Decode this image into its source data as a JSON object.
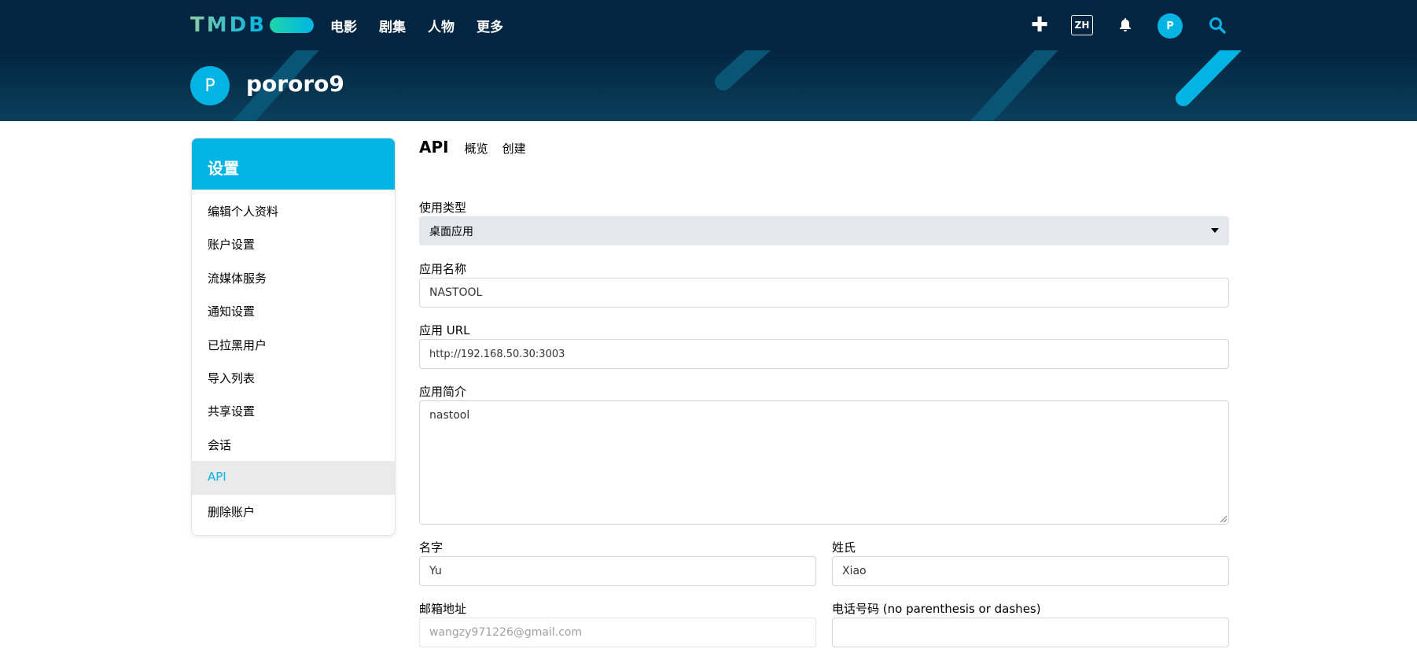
{
  "nav": {
    "logo": "TMDB",
    "links": [
      "电影",
      "剧集",
      "人物",
      "更多"
    ],
    "lang": "ZH",
    "avatar_letter": "P",
    "plus_glyph": "✚"
  },
  "profile": {
    "avatar_letter": "P",
    "username": "pororo9"
  },
  "sidebar": {
    "title": "设置",
    "items": [
      {
        "label": "编辑个人资料"
      },
      {
        "label": "账户设置"
      },
      {
        "label": "流媒体服务"
      },
      {
        "label": "通知设置"
      },
      {
        "label": "已拉黑用户"
      },
      {
        "label": "导入列表"
      },
      {
        "label": "共享设置"
      },
      {
        "label": "会话"
      },
      {
        "label": "API",
        "active": true
      },
      {
        "label": "删除账户"
      }
    ]
  },
  "subnav": {
    "title": "API",
    "links": [
      "概览",
      "创建"
    ]
  },
  "form": {
    "usage_type": {
      "label": "使用类型",
      "value": "桌面应用"
    },
    "app_name": {
      "label": "应用名称",
      "value": "NASTOOL"
    },
    "app_url": {
      "label": "应用 URL",
      "value": "http://192.168.50.30:3003"
    },
    "app_summary": {
      "label": "应用简介",
      "value": "nastool"
    },
    "first_name": {
      "label": "名字",
      "value": "Yu"
    },
    "last_name": {
      "label": "姓氏",
      "value": "Xiao"
    },
    "email": {
      "label": "邮箱地址",
      "value": "wangzy971226@gmail.com"
    },
    "phone": {
      "label": "电话号码 (no parenthesis or dashes)",
      "value": ""
    }
  },
  "colors": {
    "nav_bg": "#032541",
    "accent": "#01b4e4",
    "logo_green": "#90cea1"
  }
}
